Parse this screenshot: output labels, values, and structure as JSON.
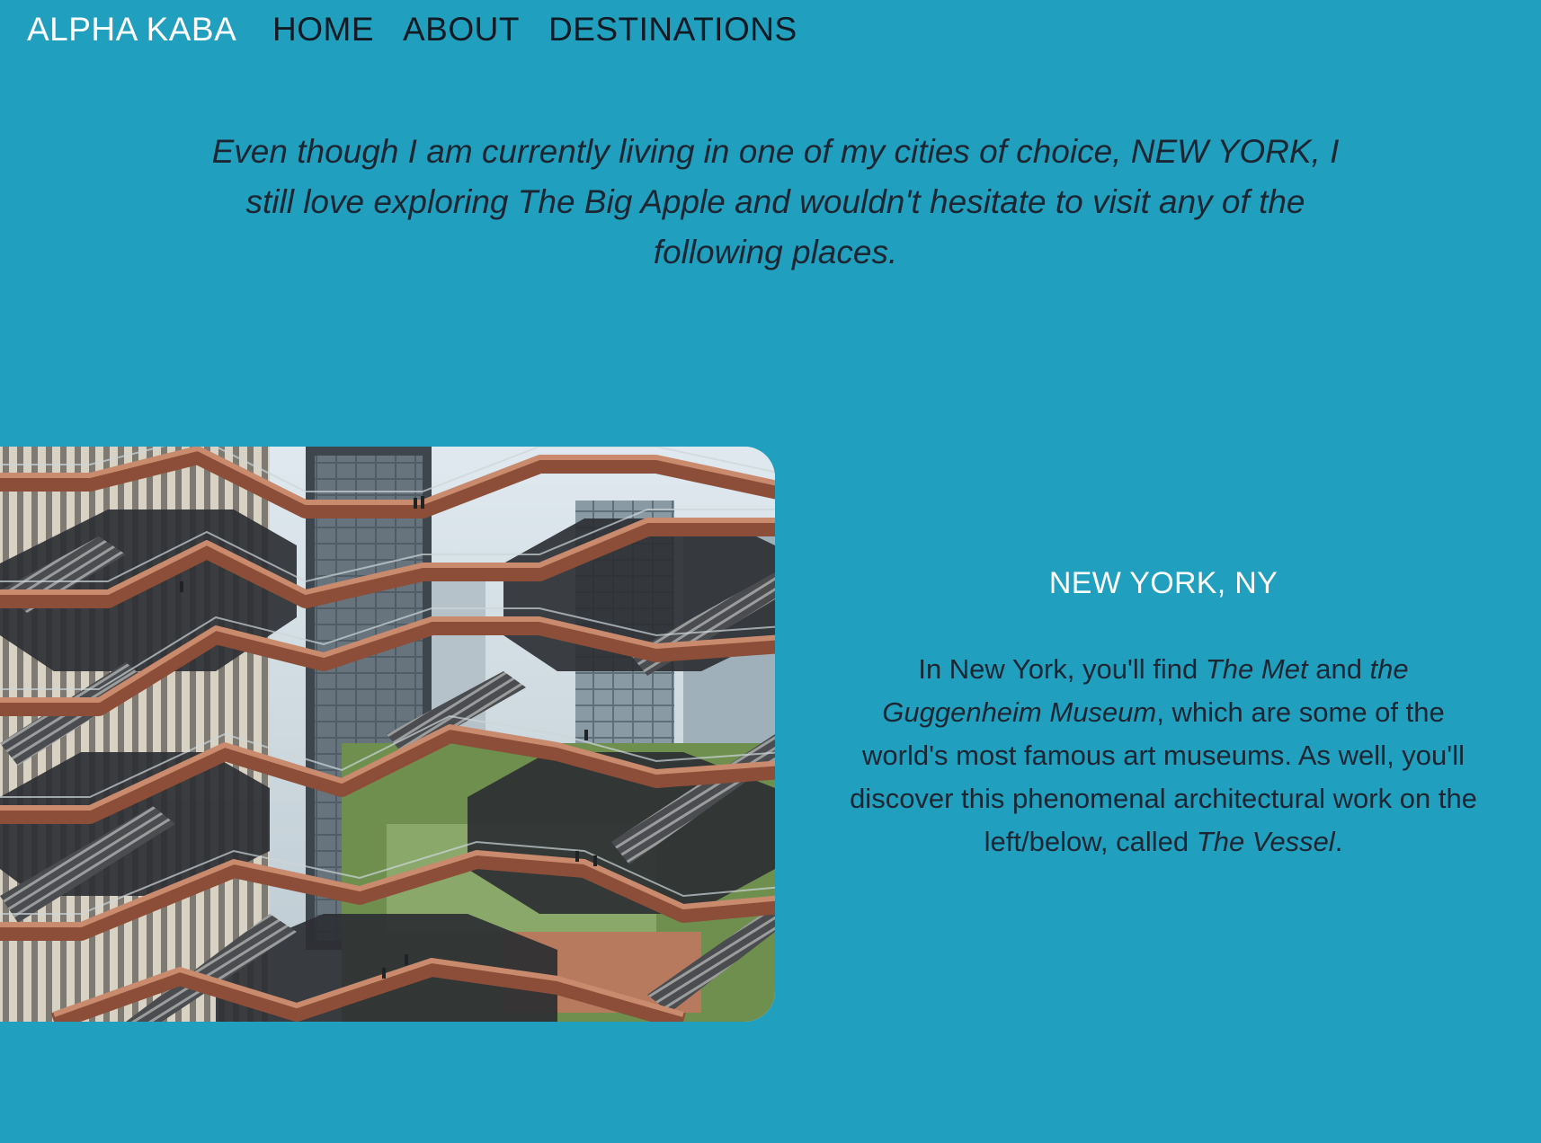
{
  "nav": {
    "brand": "ALPHA KABA",
    "links": [
      "HOME",
      "ABOUT",
      "DESTINATIONS"
    ]
  },
  "intro": {
    "text": "Even though I am currently living in one of my cities of choice, NEW YORK, I still love exploring The Big Apple and wouldn't hesitate to visit any of the following places."
  },
  "destination": {
    "title": "NEW YORK, NY",
    "body": {
      "p1": "In New York, you'll find ",
      "em1": "The Met",
      "p2": " and ",
      "em2": "the Guggenheim Museum",
      "p3": ", which are some of the world's most famous art museums. As well, you'll discover this phenomenal architectural work on the left/below, called ",
      "em3": "The Vessel",
      "p4": "."
    }
  },
  "colors": {
    "background": "#219fbf",
    "accent_text": "#ffffff",
    "body_text": "#1c2733",
    "copper": "#a0624a"
  }
}
